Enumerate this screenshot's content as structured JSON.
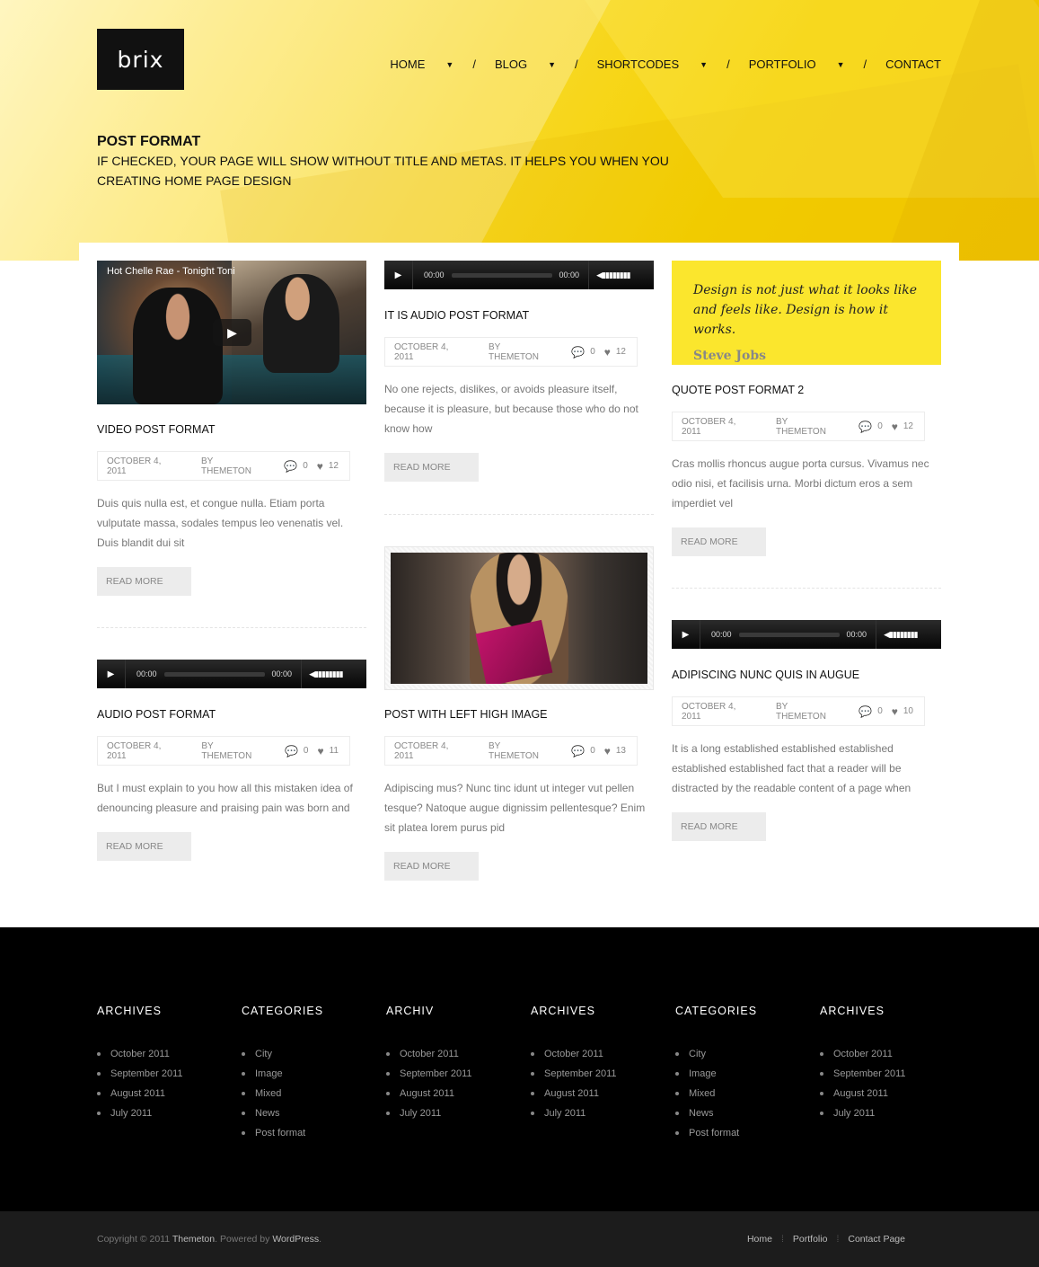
{
  "brand": {
    "logo_text": "brix"
  },
  "nav": [
    {
      "label": "HOME",
      "has_dropdown": true
    },
    {
      "label": "BLOG",
      "has_dropdown": true
    },
    {
      "label": "SHORTCODES",
      "has_dropdown": true
    },
    {
      "label": "PORTFOLIO",
      "has_dropdown": true
    },
    {
      "label": "CONTACT",
      "has_dropdown": false
    }
  ],
  "nav_separator": "/",
  "nav_arrow": "▼",
  "hero": {
    "title": "POST FORMAT",
    "subtitle": "IF CHECKED, YOUR PAGE WILL SHOW WITHOUT TITLE AND METAS. IT HELPS YOU WHEN YOU CREATING HOME PAGE DESIGN"
  },
  "posts": {
    "video_post": {
      "video_title": "Hot Chelle Rae - Tonight Toni",
      "title": "VIDEO POST FORMAT",
      "date": "OCTOBER 4, 2011",
      "author": "BY THEMETON",
      "comments": "0",
      "likes": "12",
      "excerpt": "Duis quis nulla est, et congue nulla. Etiam porta vulputate massa, sodales tempus leo venenatis vel. Duis blandit dui sit",
      "read_more": "READ MORE"
    },
    "audio_post_1": {
      "time_current": "00:00",
      "time_total": "00:00",
      "title": "AUDIO POST FORMAT",
      "date": "OCTOBER 4, 2011",
      "author": "BY THEMETON",
      "comments": "0",
      "likes": "11",
      "excerpt": "But I must explain to you how all this mistaken idea of denouncing pleasure and praising pain was born and",
      "read_more": "READ MORE"
    },
    "audio_post_2": {
      "time_current": "00:00",
      "time_total": "00:00",
      "title": "IT IS AUDIO POST FORMAT",
      "date": "OCTOBER 4, 2011",
      "author": "BY THEMETON",
      "comments": "0",
      "likes": "12",
      "excerpt": "No one rejects, dislikes, or avoids pleasure itself, because it is pleasure, but because those who do not know how",
      "read_more": "READ MORE"
    },
    "image_post": {
      "title": "POST WITH LEFT HIGH IMAGE",
      "date": "OCTOBER 4, 2011",
      "author": "BY THEMETON",
      "comments": "0",
      "likes": "13",
      "excerpt": "Adipiscing mus? Nunc tinc idunt ut integer vut pellen tesque? Natoque augue dignissim pellentesque? Enim sit platea lorem purus pid",
      "read_more": "READ MORE"
    },
    "quote_post": {
      "quote_text": "Design is not just what it looks like and feels like. Design is how it works.",
      "quote_author": "Steve Jobs",
      "title": "QUOTE POST FORMAT 2",
      "date": "OCTOBER 4, 2011",
      "author": "BY THEMETON",
      "comments": "0",
      "likes": "12",
      "excerpt": "Cras mollis rhoncus augue porta cursus. Vivamus nec odio nisi, et facilisis urna. Morbi dictum eros a sem imperdiet vel",
      "read_more": "READ MORE"
    },
    "audio_post_3": {
      "time_current": "00:00",
      "time_total": "00:00",
      "title": "ADIPISCING NUNC QUIS IN AUGUE",
      "date": "OCTOBER 4, 2011",
      "author": "BY THEMETON",
      "comments": "0",
      "likes": "10",
      "excerpt": "It is a long established established established established established fact that a reader will be distracted by the readable content of a page when",
      "read_more": "READ MORE"
    }
  },
  "footer": {
    "columns": [
      {
        "heading": "ARCHIVES",
        "items": [
          "October 2011",
          "September 2011",
          "August 2011",
          "July 2011"
        ]
      },
      {
        "heading": "CATEGORIES",
        "items": [
          "City",
          "Image",
          "Mixed",
          "News",
          "Post format"
        ]
      },
      {
        "heading": "ARCHIV",
        "items": [
          "October 2011",
          "September 2011",
          "August 2011",
          "July 2011"
        ]
      },
      {
        "heading": "ARCHIVES",
        "items": [
          "October 2011",
          "September 2011",
          "August 2011",
          "July 2011"
        ]
      },
      {
        "heading": "CATEGORIES",
        "items": [
          "City",
          "Image",
          "Mixed",
          "News",
          "Post format"
        ]
      },
      {
        "heading": "ARCHIVES",
        "items": [
          "October 2011",
          "September 2011",
          "August 2011",
          "July 2011"
        ]
      }
    ],
    "copyright_prefix": "Copyright © 2011",
    "copyright_brand": "Themeton",
    "powered_by_prefix": ". Powered by",
    "powered_by_brand": "WordPress",
    "powered_by_suffix": ".",
    "bottom_links": [
      "Home",
      "Portfolio",
      "Contact Page"
    ],
    "bottom_link_separator": "⁞"
  },
  "colors": {
    "accent_yellow": "#f5d100",
    "quote_yellow": "#fbe62d",
    "footer_bg": "#000000",
    "bottom_bar_bg": "#1c1c1c"
  },
  "icons": {
    "play": "play-icon",
    "volume": "volume-icon",
    "comment": "comment-icon",
    "like": "heart-icon"
  }
}
